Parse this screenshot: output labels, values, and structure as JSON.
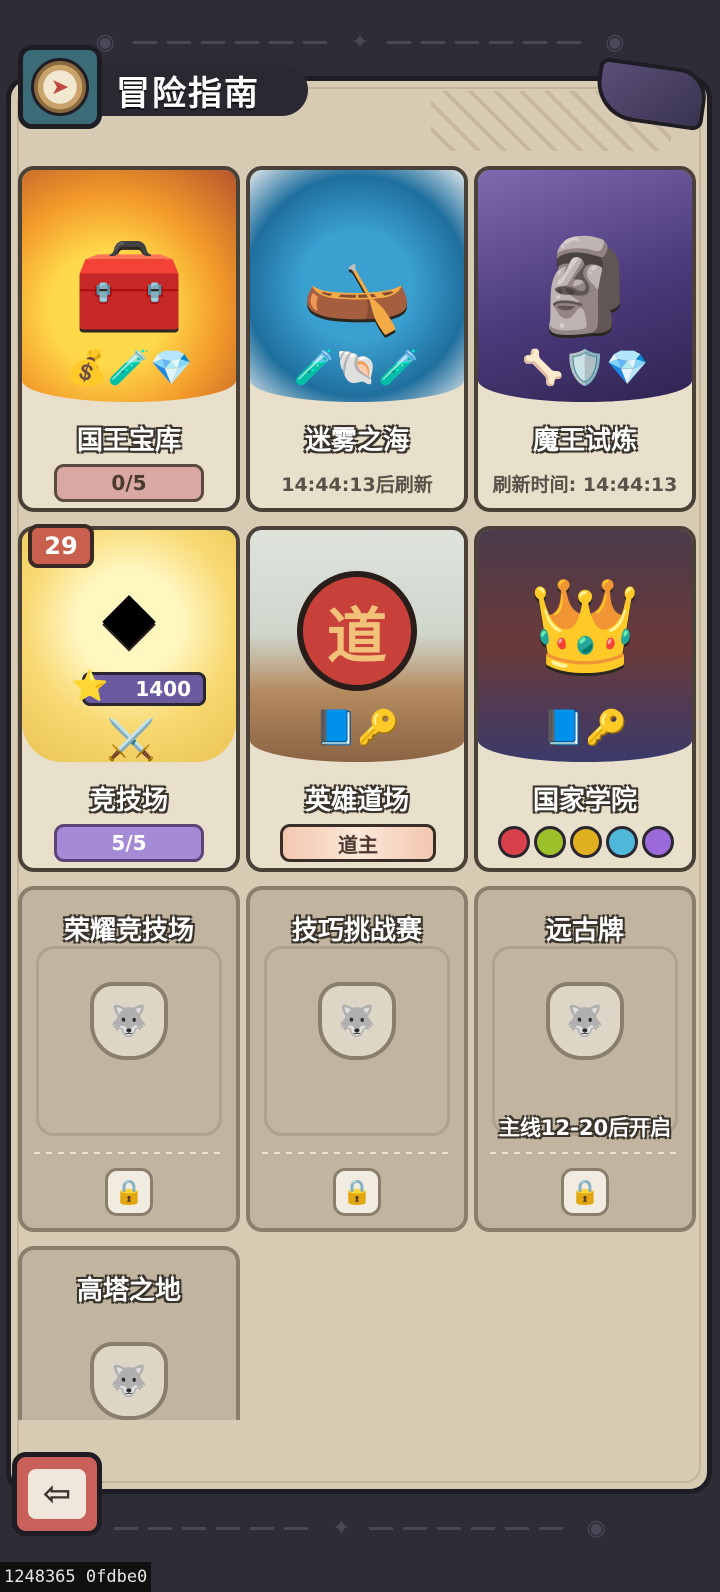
{
  "header": {
    "title": "冒险指南"
  },
  "cards": {
    "king_vault": {
      "name": "国王宝库",
      "progress": "0/5"
    },
    "mist_sea": {
      "name": "迷雾之海",
      "refresh_text": "14:44:13后刷新"
    },
    "demon_trial": {
      "name": "魔王试炼",
      "refresh_text": "刷新时间: 14:44:13"
    },
    "arena": {
      "name": "竞技场",
      "rank": "29",
      "score": "1400",
      "progress": "5/5"
    },
    "hero_dojo": {
      "name": "英雄道场",
      "badge_char": "道",
      "title": "道主"
    },
    "academy": {
      "name": "国家学院",
      "dot_colors": [
        "#d8404a",
        "#9cbf2a",
        "#e0b020",
        "#4fb8d8",
        "#9c6ad8"
      ]
    },
    "glory_arena": {
      "name": "荣耀竞技场"
    },
    "skill_challenge": {
      "name": "技巧挑战赛"
    },
    "ancient_cards": {
      "name": "远古牌",
      "unlock_condition": "主线12-20后开启"
    },
    "tower_land": {
      "name": "高塔之地"
    }
  },
  "colors": {
    "panel": "#d8cbb3",
    "background": "#2e2c36",
    "accent_red": "#c9605a"
  },
  "footer": {
    "debug_text": "1248365 0fdbe0"
  }
}
